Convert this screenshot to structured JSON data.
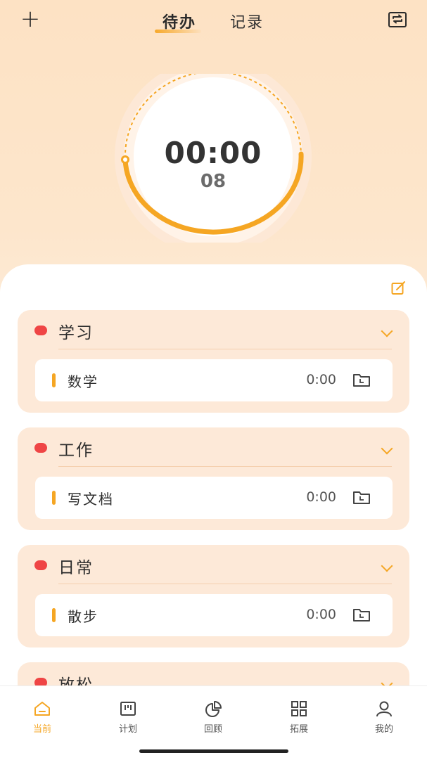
{
  "header": {
    "add_icon": "plus-icon",
    "tabs": [
      {
        "label": "待办",
        "active": true
      },
      {
        "label": "记录",
        "active": false
      }
    ],
    "switch_icon": "refresh-square-icon",
    "accent": "#f7a92b"
  },
  "timer": {
    "time": "00:00",
    "sub": "08"
  },
  "list": {
    "edit_icon": "edit-icon",
    "groups": [
      {
        "title": "学习",
        "dot_color": "#ef4545",
        "tasks": [
          {
            "name": "数学",
            "time": "0:00"
          }
        ]
      },
      {
        "title": "工作",
        "dot_color": "#ef4545",
        "tasks": [
          {
            "name": "写文档",
            "time": "0:00"
          }
        ]
      },
      {
        "title": "日常",
        "dot_color": "#ef4545",
        "tasks": [
          {
            "name": "散步",
            "time": "0:00"
          }
        ]
      },
      {
        "title": "放松",
        "dot_color": "#ef4545",
        "tasks": []
      }
    ]
  },
  "nav": {
    "items": [
      {
        "label": "当前",
        "icon": "home-icon",
        "active": true
      },
      {
        "label": "计划",
        "icon": "board-icon",
        "active": false
      },
      {
        "label": "回顾",
        "icon": "pie-chart-icon",
        "active": false
      },
      {
        "label": "拓展",
        "icon": "grid-icon",
        "active": false
      },
      {
        "label": "我的",
        "icon": "user-icon",
        "active": false
      }
    ]
  }
}
